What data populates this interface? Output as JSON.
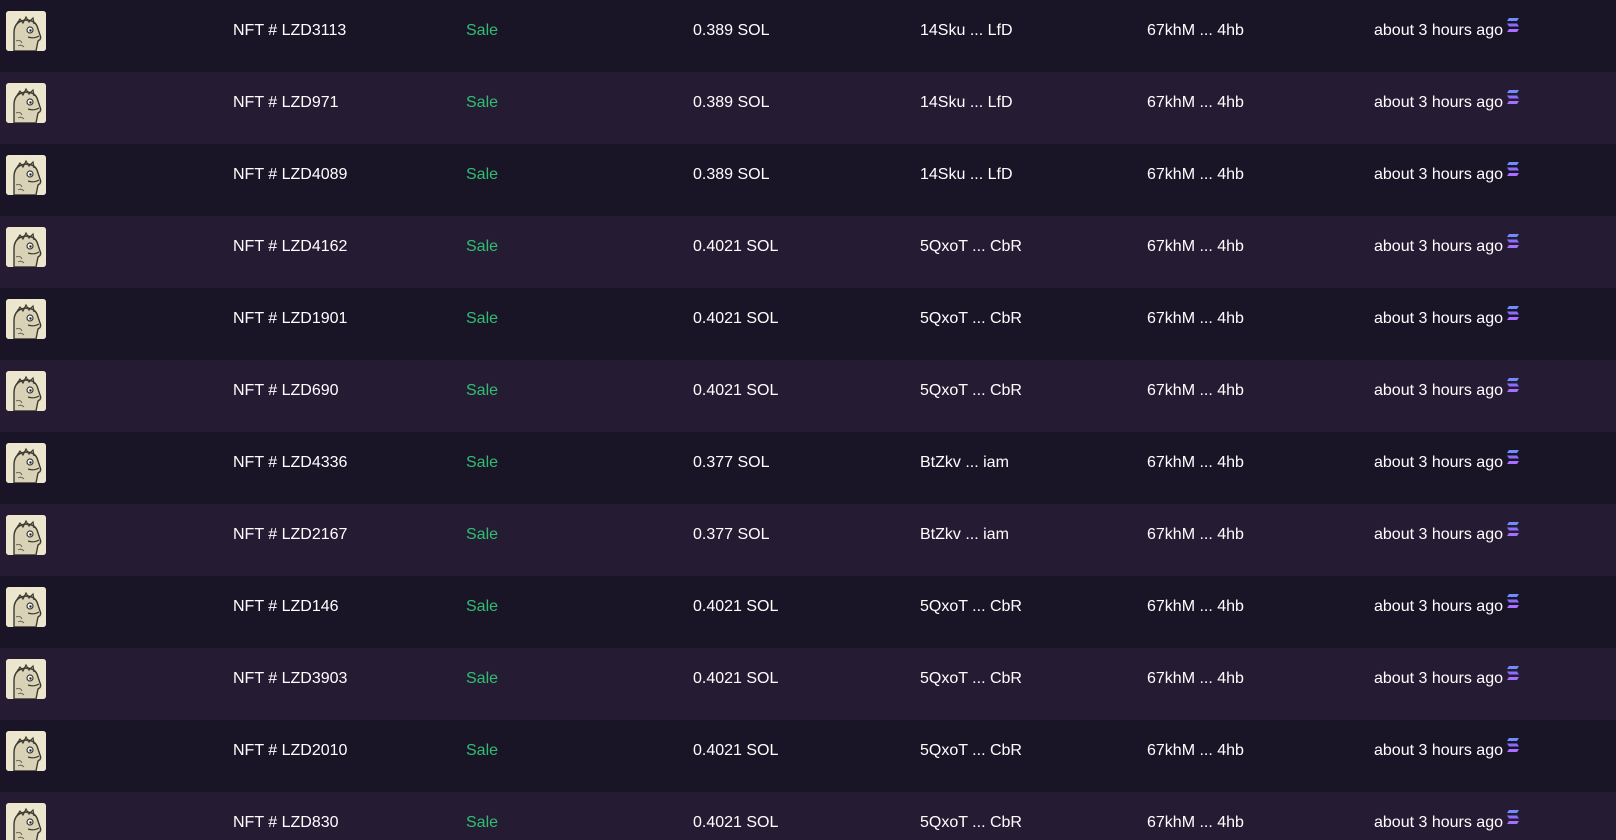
{
  "colors": {
    "row_dark": "#1a1526",
    "row_light": "#251c34",
    "sale_green": "#2fbf71",
    "solana_purple": "#8a6dff"
  },
  "icons": {
    "thumbnail": "nft-thumbnail-icon",
    "marketplace": "solana-icon"
  },
  "rows": [
    {
      "name": "NFT # LZD3113",
      "type": "Sale",
      "price": "0.389 SOL",
      "buyer": "14Sku ... LfD",
      "seller": "67khM ... 4hb",
      "time": "about 3 hours ago"
    },
    {
      "name": "NFT # LZD971",
      "type": "Sale",
      "price": "0.389 SOL",
      "buyer": "14Sku ... LfD",
      "seller": "67khM ... 4hb",
      "time": "about 3 hours ago"
    },
    {
      "name": "NFT # LZD4089",
      "type": "Sale",
      "price": "0.389 SOL",
      "buyer": "14Sku ... LfD",
      "seller": "67khM ... 4hb",
      "time": "about 3 hours ago"
    },
    {
      "name": "NFT # LZD4162",
      "type": "Sale",
      "price": "0.4021 SOL",
      "buyer": "5QxoT ... CbR",
      "seller": "67khM ... 4hb",
      "time": "about 3 hours ago"
    },
    {
      "name": "NFT # LZD1901",
      "type": "Sale",
      "price": "0.4021 SOL",
      "buyer": "5QxoT ... CbR",
      "seller": "67khM ... 4hb",
      "time": "about 3 hours ago"
    },
    {
      "name": "NFT # LZD690",
      "type": "Sale",
      "price": "0.4021 SOL",
      "buyer": "5QxoT ... CbR",
      "seller": "67khM ... 4hb",
      "time": "about 3 hours ago"
    },
    {
      "name": "NFT # LZD4336",
      "type": "Sale",
      "price": "0.377 SOL",
      "buyer": "BtZkv ... iam",
      "seller": "67khM ... 4hb",
      "time": "about 3 hours ago"
    },
    {
      "name": "NFT # LZD2167",
      "type": "Sale",
      "price": "0.377 SOL",
      "buyer": "BtZkv ... iam",
      "seller": "67khM ... 4hb",
      "time": "about 3 hours ago"
    },
    {
      "name": "NFT # LZD146",
      "type": "Sale",
      "price": "0.4021 SOL",
      "buyer": "5QxoT ... CbR",
      "seller": "67khM ... 4hb",
      "time": "about 3 hours ago"
    },
    {
      "name": "NFT # LZD3903",
      "type": "Sale",
      "price": "0.4021 SOL",
      "buyer": "5QxoT ... CbR",
      "seller": "67khM ... 4hb",
      "time": "about 3 hours ago"
    },
    {
      "name": "NFT # LZD2010",
      "type": "Sale",
      "price": "0.4021 SOL",
      "buyer": "5QxoT ... CbR",
      "seller": "67khM ... 4hb",
      "time": "about 3 hours ago"
    },
    {
      "name": "NFT # LZD830",
      "type": "Sale",
      "price": "0.4021 SOL",
      "buyer": "5QxoT ... CbR",
      "seller": "67khM ... 4hb",
      "time": "about 3 hours ago"
    }
  ]
}
